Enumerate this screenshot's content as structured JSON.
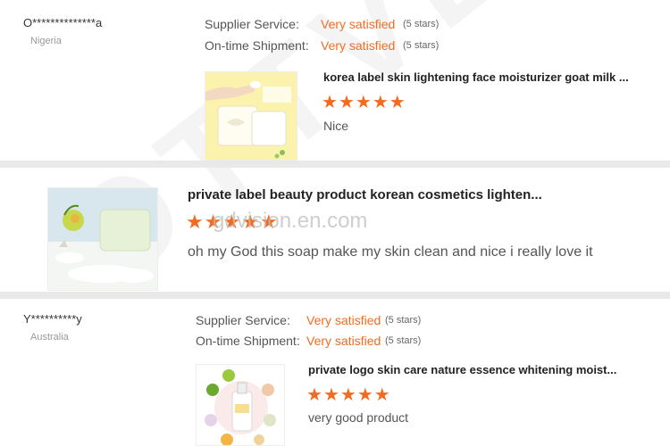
{
  "reviews": [
    {
      "reviewer": "O**************a",
      "country": "Nigeria",
      "supplier_service_label": "Supplier Service:",
      "supplier_service_value": "Very satisfied",
      "supplier_service_stars": "(5 stars)",
      "shipment_label": "On-time Shipment:",
      "shipment_value": "Very satisfied",
      "shipment_stars": "(5 stars)",
      "product_title": "korea label skin lightening face moisturizer goat milk ...",
      "rating": 5,
      "comment": "Nice"
    },
    {
      "product_title": "private label beauty product korean cosmetics lighten...",
      "rating": 5,
      "comment": "oh my God this soap make my skin clean and nice i really love it"
    },
    {
      "reviewer": "Y**********y",
      "country": "Australia",
      "supplier_service_label": "Supplier Service:",
      "supplier_service_value": "Very satisfied",
      "supplier_service_stars": "(5 stars)",
      "shipment_label": "On-time Shipment:",
      "shipment_value": "Very satisfied",
      "shipment_stars": "(5 stars)",
      "product_title": "private logo skin care nature essence whitening moist...",
      "rating": 5,
      "comment": "very good product"
    }
  ],
  "watermark": {
    "diagonal": "OTTVENA",
    "center": "gdvision.en.com"
  },
  "colors": {
    "accent": "#f26b21",
    "divider": "#e9e9e9"
  }
}
